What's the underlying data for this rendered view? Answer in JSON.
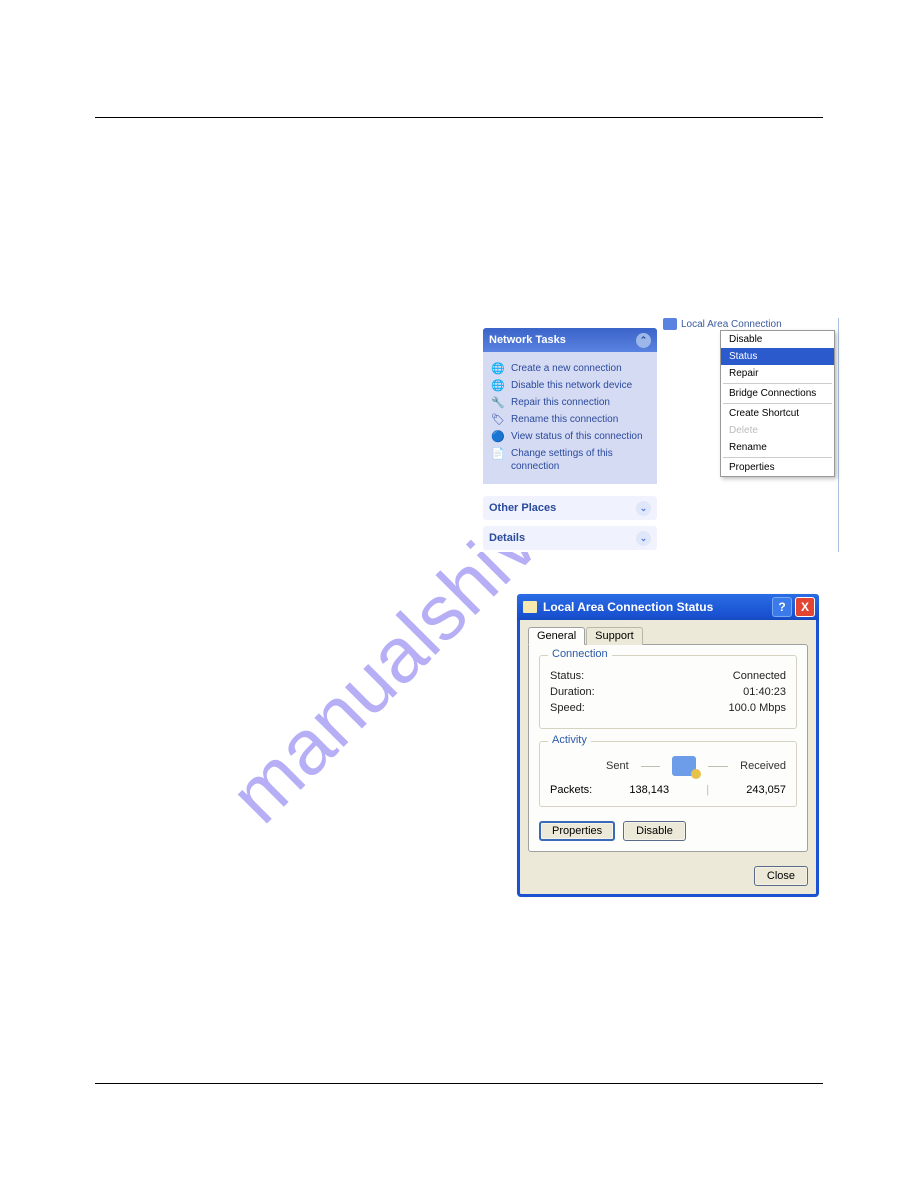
{
  "watermark": "manualshive.com",
  "shot1": {
    "tasks_header": "Network Tasks",
    "tasks": [
      "Create a new connection",
      "Disable this network device",
      "Repair this connection",
      "Rename this connection",
      "View status of this connection",
      "Change settings of this connection"
    ],
    "other_places": "Other Places",
    "details": "Details",
    "lan_label": "Local Area Connection",
    "menu": {
      "disable": "Disable",
      "status": "Status",
      "repair": "Repair",
      "bridge": "Bridge Connections",
      "shortcut": "Create Shortcut",
      "delete": "Delete",
      "rename": "Rename",
      "properties": "Properties"
    }
  },
  "shot2": {
    "title": "Local Area Connection Status",
    "help": "?",
    "close_x": "X",
    "tab_general": "General",
    "tab_support": "Support",
    "grp_connection": "Connection",
    "status_label": "Status:",
    "status_value": "Connected",
    "duration_label": "Duration:",
    "duration_value": "01:40:23",
    "speed_label": "Speed:",
    "speed_value": "100.0 Mbps",
    "grp_activity": "Activity",
    "sent": "Sent",
    "received": "Received",
    "packets_label": "Packets:",
    "packets_sent": "138,143",
    "packets_divider": "|",
    "packets_received": "243,057",
    "btn_properties": "Properties",
    "btn_disable": "Disable",
    "btn_close": "Close"
  }
}
